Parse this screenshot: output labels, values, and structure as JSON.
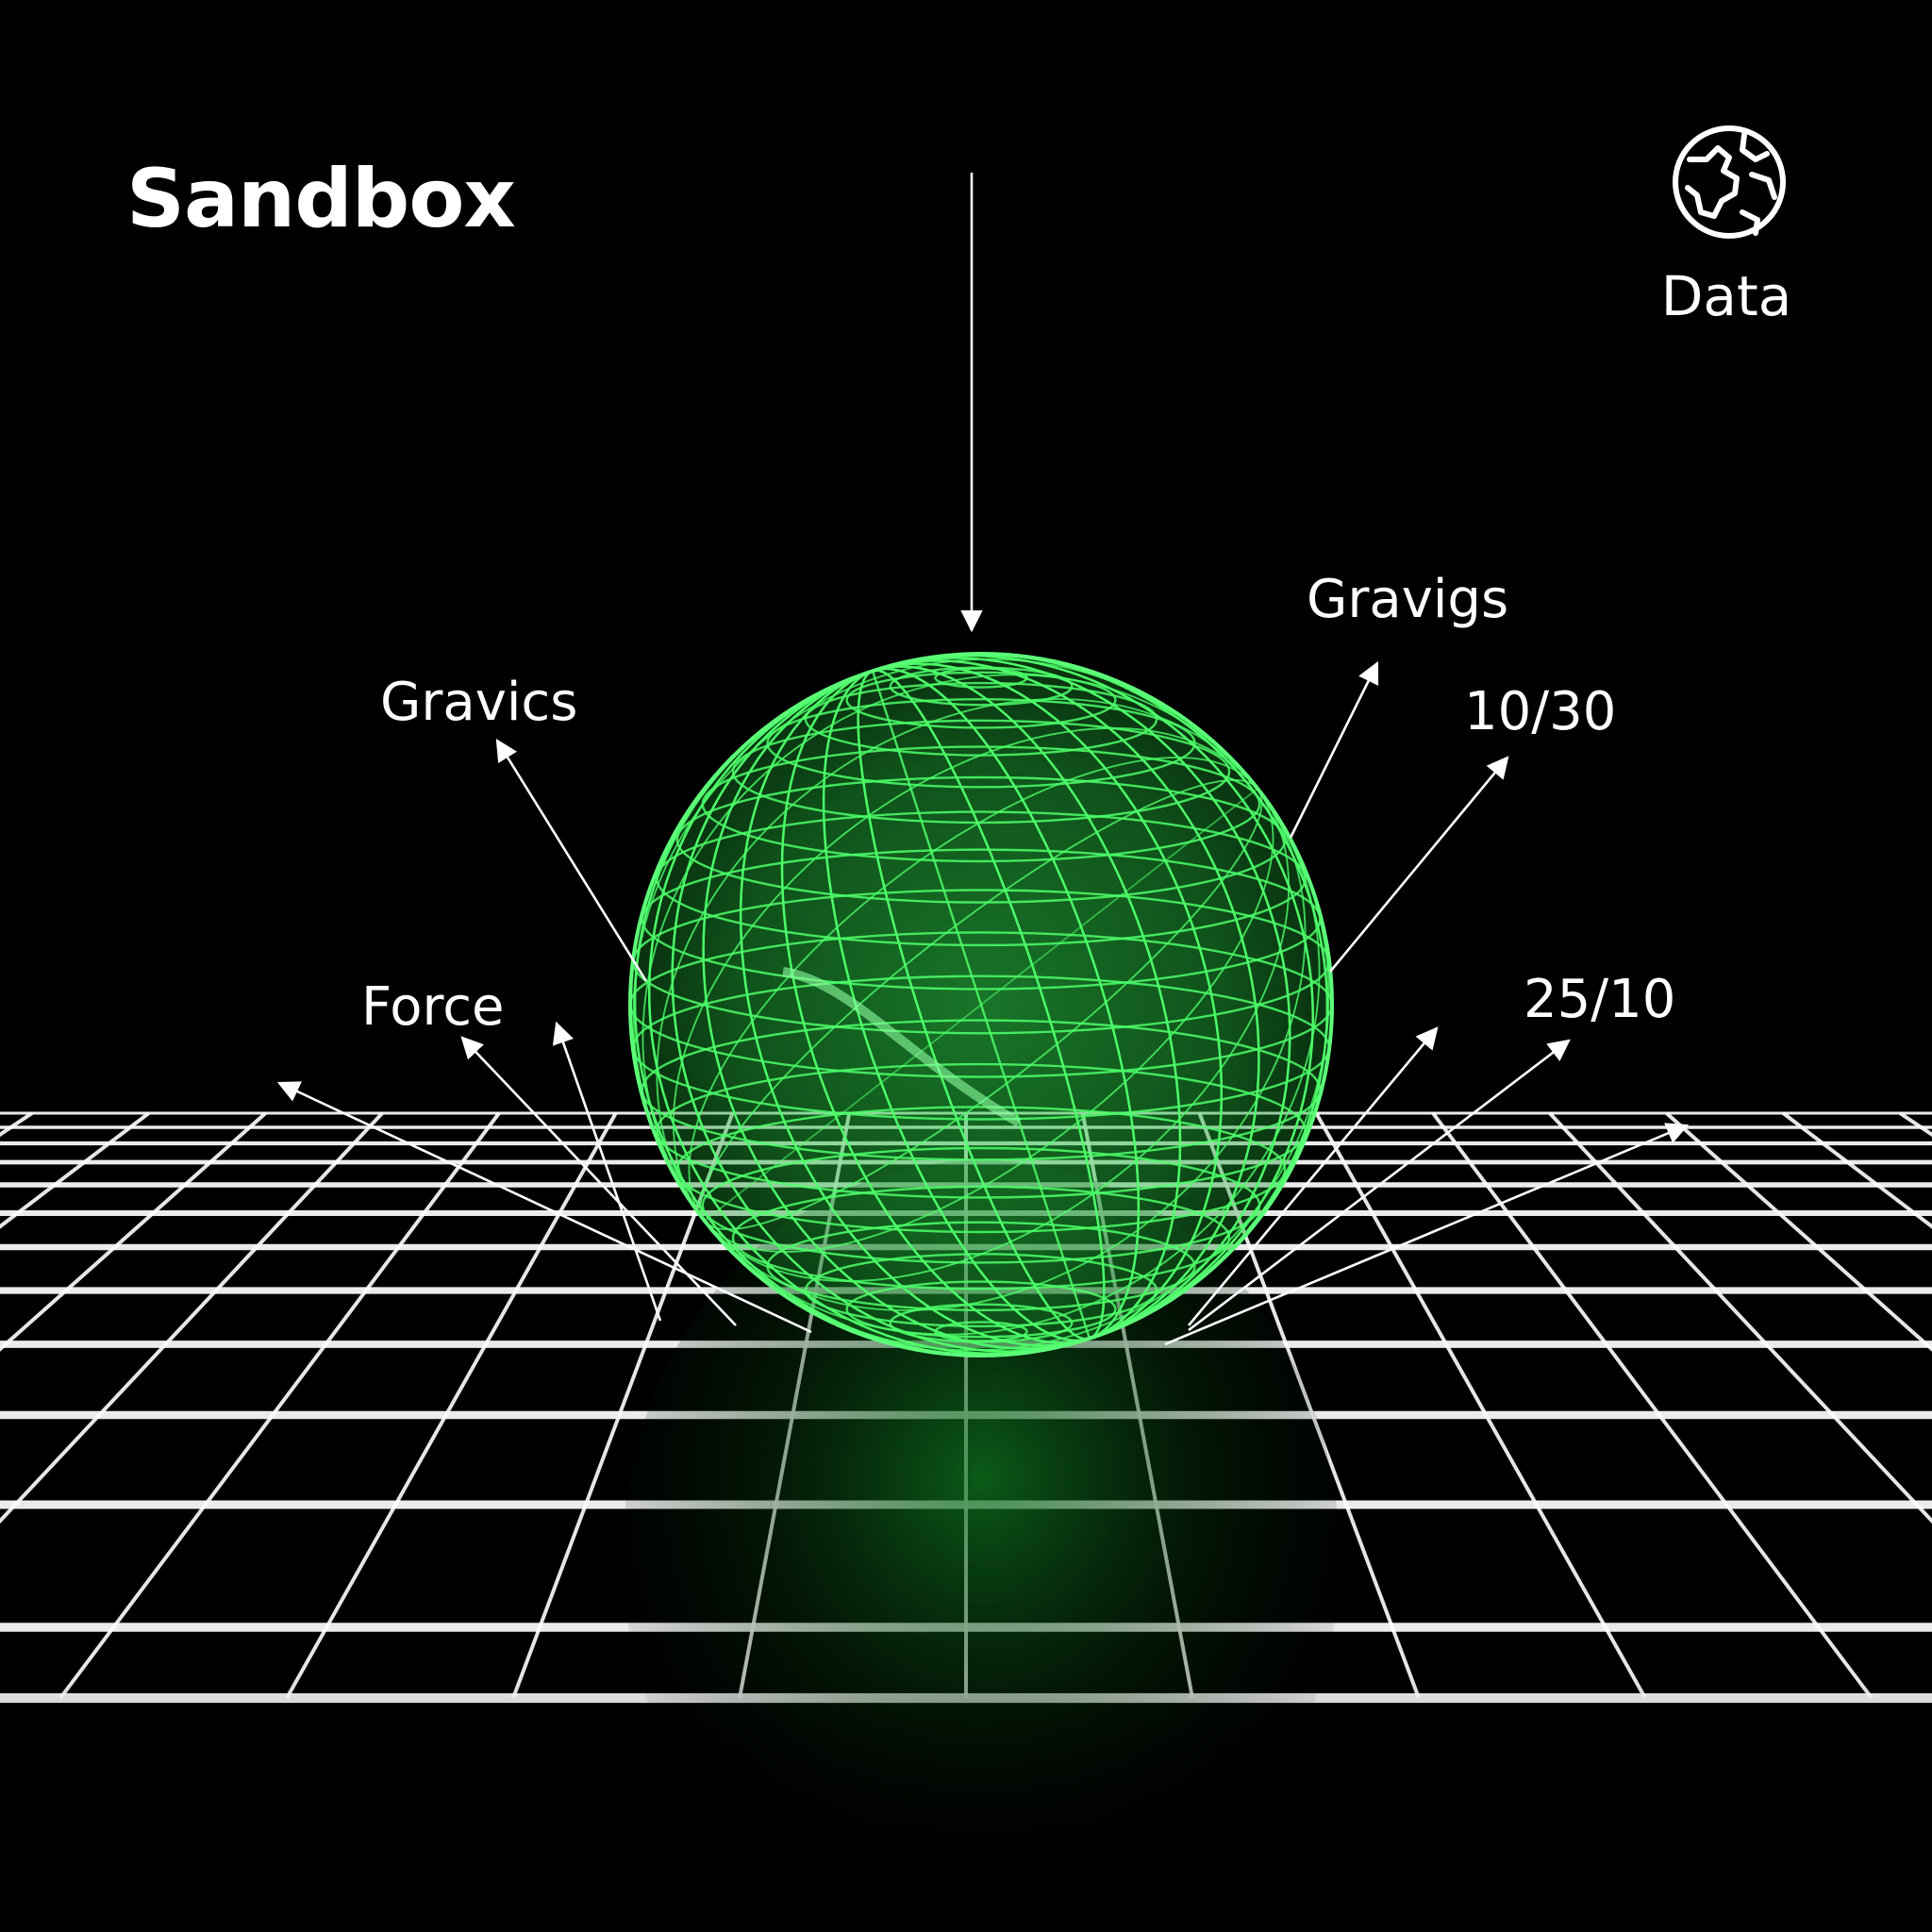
{
  "header": {
    "title": "Sandbox"
  },
  "data_button": {
    "label": "Data",
    "icon": "globe-icon"
  },
  "annotations": {
    "gravics": "Gravics",
    "gravigs": "Gravigs",
    "ratio_1": "10/30",
    "force": "Force",
    "ratio_2": "25/10"
  },
  "colors": {
    "background": "#000000",
    "sphere_wireframe": "#4dff6a",
    "grid": "#ffffff",
    "text": "#ffffff"
  }
}
